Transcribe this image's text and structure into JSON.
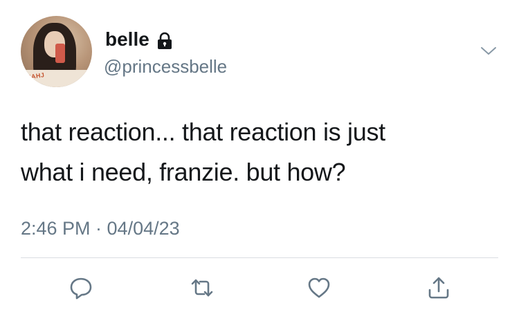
{
  "tweet": {
    "display_name": "belle",
    "handle": "@princessbelle",
    "protected_icon": "lock-icon",
    "text_line1": "that reaction... that reaction is just",
    "text_line2": "what i need, franzie. but how?",
    "timestamp": "2:46 PM · 04/04/23"
  },
  "avatar": {
    "shirt_text": "ЯAHJ"
  },
  "actions": [
    {
      "icon": "reply-icon"
    },
    {
      "icon": "retweet-icon"
    },
    {
      "icon": "like-icon"
    },
    {
      "icon": "share-icon"
    }
  ],
  "colors": {
    "primary_text": "#14171a",
    "secondary_text": "#657786",
    "divider": "#d9dde1"
  }
}
